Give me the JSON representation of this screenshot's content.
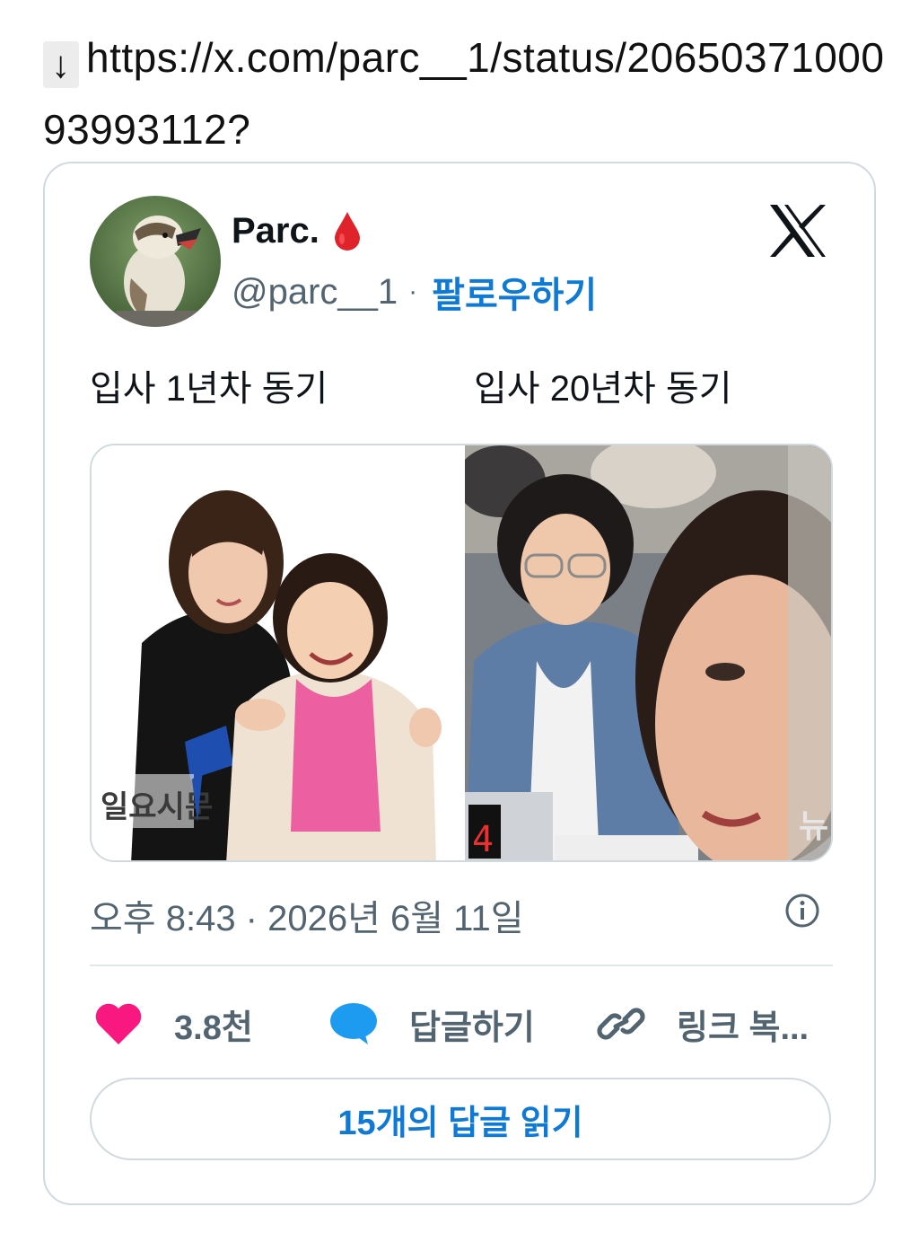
{
  "link": {
    "icon": "download-arrow-icon",
    "url": "https://x.com/parc__1/status/2065037100093993112?"
  },
  "tweet": {
    "display_name": "Parc.",
    "handle": "@parc__1",
    "separator": "·",
    "follow_label": "팔로우하기",
    "caption_left": "입사 1년차 동기",
    "caption_right": "입사 20년차 동기",
    "media_left_watermark": "일요시문",
    "media_right_corner": "뉴",
    "media_right_counter": "4",
    "timestamp": "오후 8:43 · 2026년 6월 11일",
    "actions": {
      "like_count": "3.8천",
      "reply_label": "답글하기",
      "copy_link_label": "링크 복..."
    },
    "read_replies_label": "15개의 답글 읽기"
  },
  "colors": {
    "accent": "#0f7ad6",
    "like": "#f91880",
    "reply": "#1d9bf0",
    "muted": "#536471",
    "border": "#cfd9de"
  }
}
